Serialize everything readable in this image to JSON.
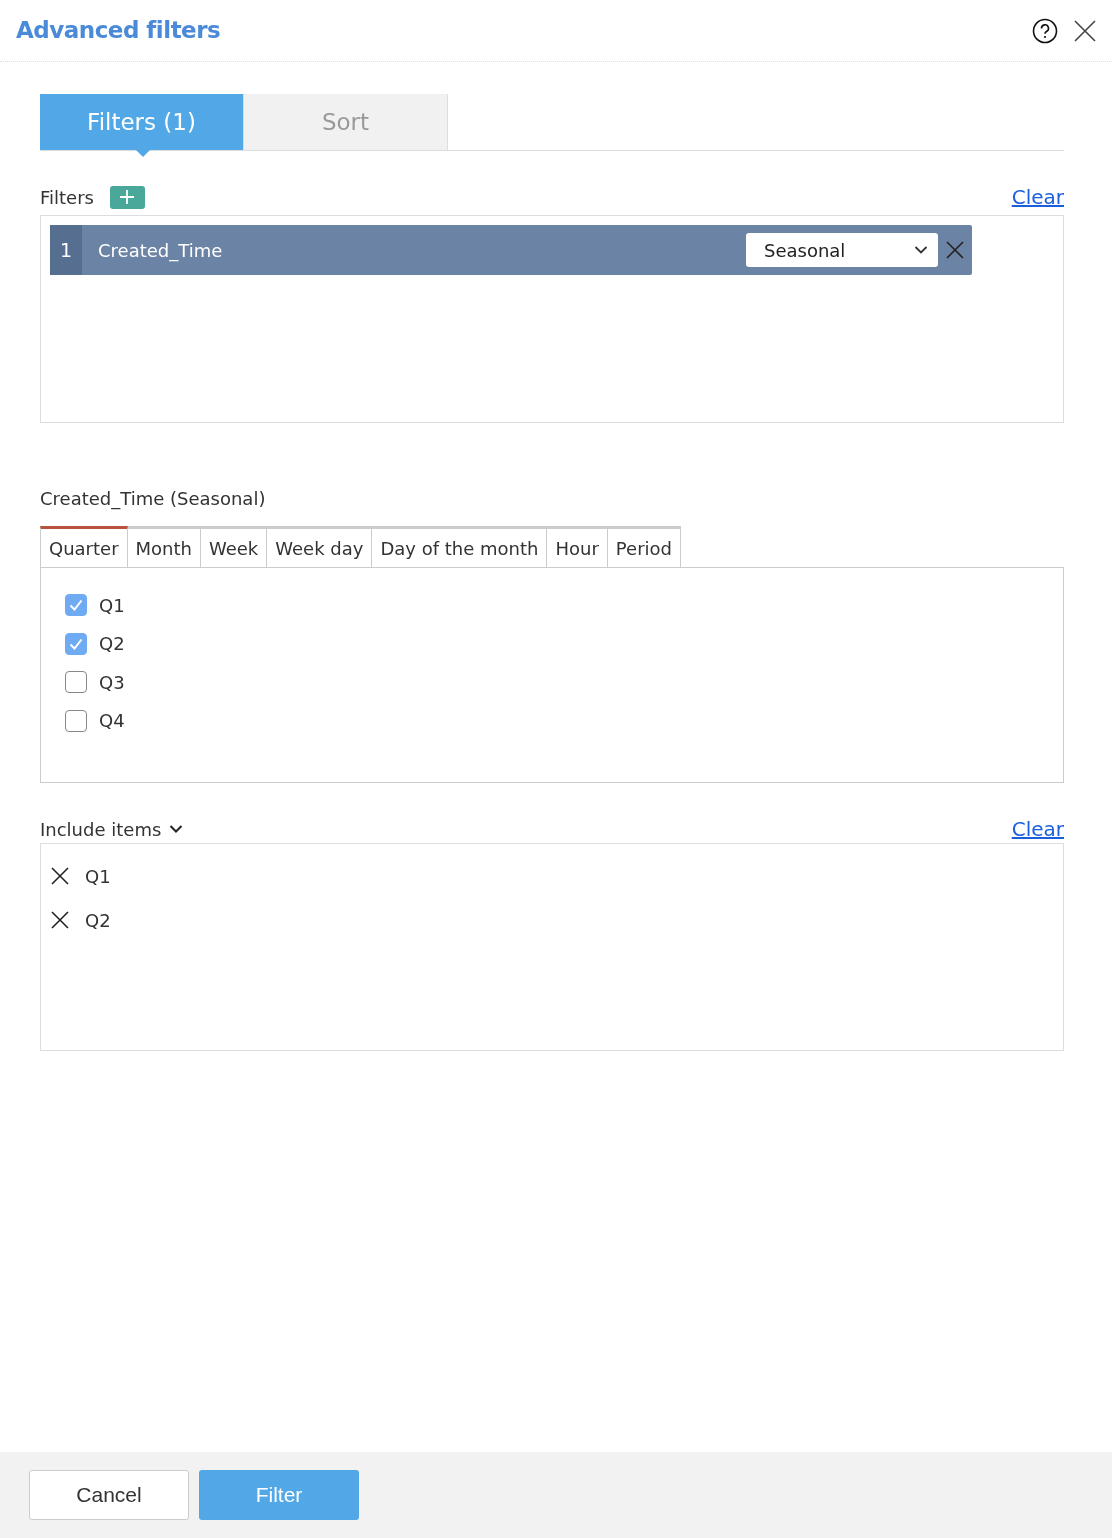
{
  "dialog": {
    "title": "Advanced filters"
  },
  "tabs": [
    {
      "label": "Filters (1)",
      "selected": true
    },
    {
      "label": "Sort",
      "selected": false
    }
  ],
  "filters": {
    "label": "Filters",
    "clear": "Clear",
    "items": [
      {
        "index": "1",
        "field": "Created_Time",
        "mode": "Seasonal"
      }
    ]
  },
  "section_title": "Created_Time (Seasonal)",
  "period_tabs": [
    {
      "label": "Quarter",
      "selected": true
    },
    {
      "label": "Month",
      "selected": false
    },
    {
      "label": "Week",
      "selected": false
    },
    {
      "label": "Week day",
      "selected": false
    },
    {
      "label": "Day of the month",
      "selected": false
    },
    {
      "label": "Hour",
      "selected": false
    },
    {
      "label": "Period",
      "selected": false
    }
  ],
  "options": [
    {
      "label": "Q1",
      "checked": true
    },
    {
      "label": "Q2",
      "checked": true
    },
    {
      "label": "Q3",
      "checked": false
    },
    {
      "label": "Q4",
      "checked": false
    }
  ],
  "include": {
    "label": "Include items",
    "clear": "Clear",
    "items": [
      "Q1",
      "Q2"
    ]
  },
  "buttons": [
    {
      "label": "Cancel",
      "kind": "secondary"
    },
    {
      "label": "Filter",
      "kind": "primary"
    }
  ]
}
